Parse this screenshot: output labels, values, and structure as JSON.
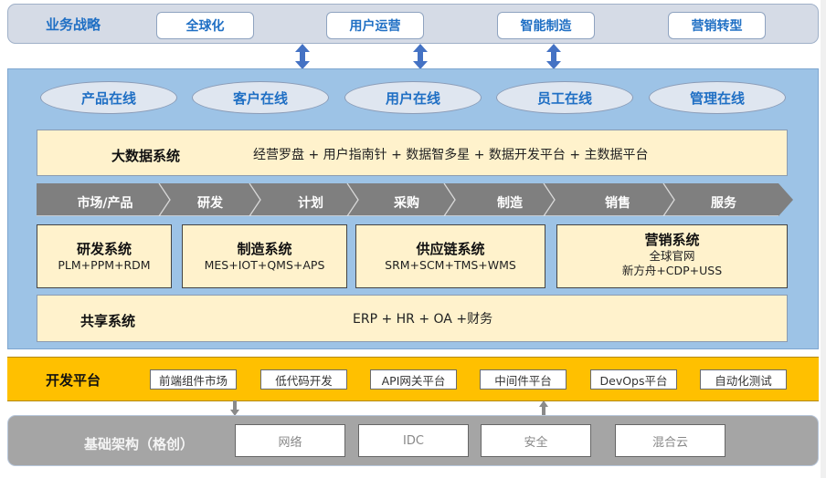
{
  "strategy": {
    "title": "业务战略",
    "items": [
      "全球化",
      "用户运营",
      "智能制造",
      "营销转型"
    ]
  },
  "online": {
    "items": [
      "产品在线",
      "客户在线",
      "用户在线",
      "员工在线",
      "管理在线"
    ]
  },
  "bigdata": {
    "title": "大数据系统",
    "description": "经营罗盘 + 用户指南针 + 数据智多星 + 数据开发平台 + 主数据平台"
  },
  "process": {
    "steps": [
      "市场/产品",
      "研发",
      "计划",
      "采购",
      "制造",
      "销售",
      "服务"
    ]
  },
  "systems": [
    {
      "title": "研发系统",
      "lines": [
        "PLM+PPM+RDM"
      ]
    },
    {
      "title": "制造系统",
      "lines": [
        "MES+IOT+QMS+APS"
      ]
    },
    {
      "title": "供应链系统",
      "lines": [
        "SRM+SCM+TMS+WMS"
      ]
    },
    {
      "title": "营销系统",
      "lines": [
        "全球官网",
        "新方舟+CDP+USS"
      ]
    }
  ],
  "shared": {
    "title": "共享系统",
    "description": "ERP + HR + OA +财务"
  },
  "dev_platform": {
    "title": "开发平台",
    "items": [
      "前端组件市场",
      "低代码开发",
      "API网关平台",
      "中间件平台",
      "DevOps平台",
      "自动化测试"
    ]
  },
  "infrastructure": {
    "title": "基础架构（格创）",
    "items": [
      "网络",
      "IDC",
      "安全",
      "混合云"
    ]
  },
  "colors": {
    "strategy_bg": "#d5dbe6",
    "accent_blue": "#1f6fc4",
    "business_bg": "#9dc3e6",
    "cream": "#fff2cc",
    "process_gray": "#7f7f7f",
    "dev_yellow": "#ffc000",
    "infra_gray": "#a5a5a5",
    "arrow_blue": "#4472c4"
  }
}
